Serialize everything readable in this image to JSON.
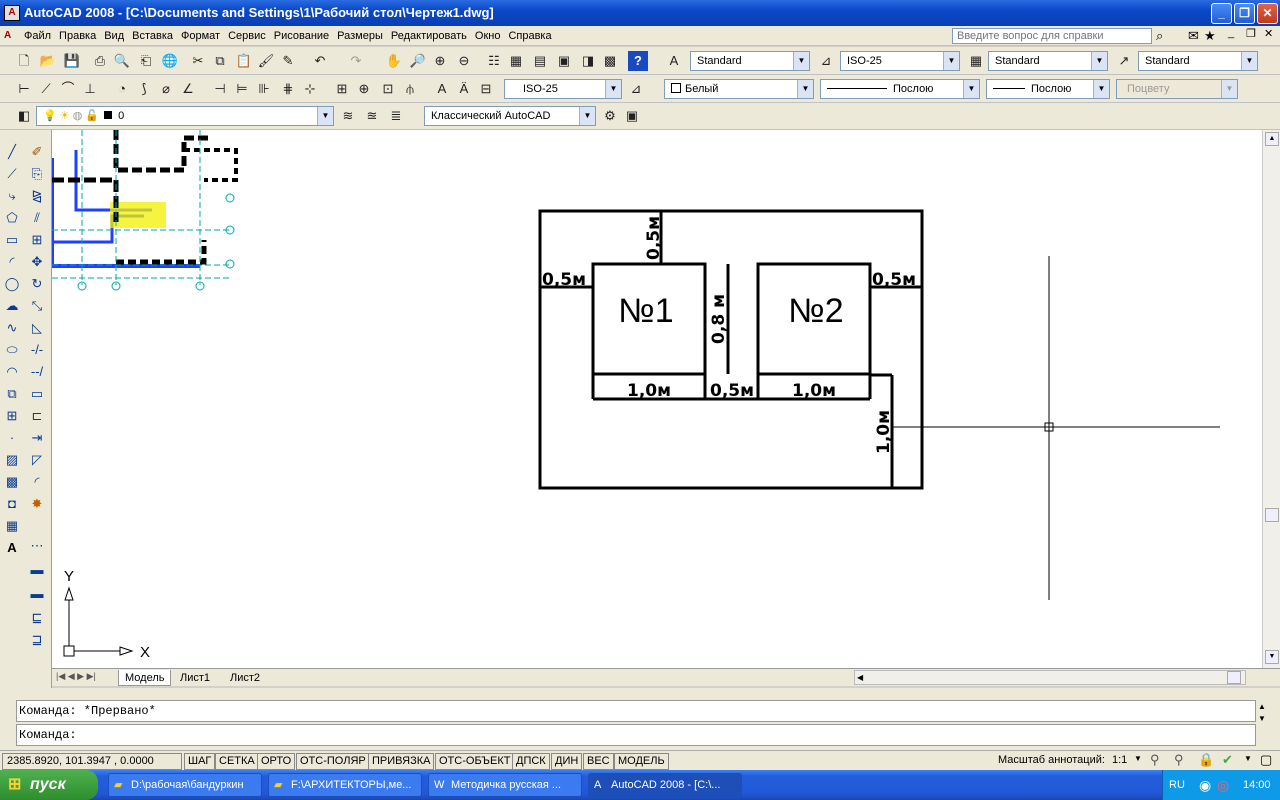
{
  "window": {
    "title": "AutoCAD 2008 - [C:\\Documents and Settings\\1\\Рабочий стол\\Чертеж1.dwg]"
  },
  "menu": [
    "Файл",
    "Правка",
    "Вид",
    "Вставка",
    "Формат",
    "Сервис",
    "Рисование",
    "Размеры",
    "Редактировать",
    "Окно",
    "Справка"
  ],
  "help_search": {
    "placeholder": "Введите вопрос для справки"
  },
  "toolbar_styles": {
    "text_style": "Standard",
    "dim_style": "ISO-25",
    "table_style": "Standard",
    "mleader_style": "Standard"
  },
  "toolbar_dims": {
    "dim_style": "ISO-25"
  },
  "toolbar_props": {
    "color": "Белый",
    "linetype": "Послою",
    "lineweight": "Послою",
    "plotstyle": "Поцвету"
  },
  "toolbar_layers": {
    "layer": "0",
    "workspace": "Классический AutoCAD"
  },
  "drawing": {
    "room1": "№1",
    "room2": "№2",
    "dims": {
      "top": "0,5м",
      "left": "0,5м",
      "right": "0,5м",
      "between": "0,8 м",
      "bottom1": "1,0м",
      "bottom_mid": "0,5м",
      "bottom2": "1,0м",
      "side": "1,0м"
    },
    "ucs": {
      "x": "X",
      "y": "Y"
    }
  },
  "tabs": [
    "Модель",
    "Лист1",
    "Лист2"
  ],
  "command": {
    "history": "Команда: *Прервано*",
    "prompt": "Команда:"
  },
  "status": {
    "coords": "2385.8920, 101.3947 , 0.0000",
    "buttons": [
      "ШАГ",
      "СЕТКА",
      "ОРТО",
      "ОТС-ПОЛЯР",
      "ПРИВЯЗКА",
      "ОТС-ОБЪЕКТ",
      "ДПСК",
      "ДИН",
      "ВЕС",
      "МОДЕЛЬ"
    ],
    "annot_label": "Масштаб аннотаций:",
    "annot_value": "1:1"
  },
  "taskbar": {
    "start": "пуск",
    "tasks": [
      "D:\\рабочая\\бандуркин",
      "F:\\АРХИТЕКТОРЫ,ме...",
      "Методичка русская ...",
      "AutoCAD 2008 - [C:\\..."
    ],
    "lang": "RU",
    "clock": "14:00"
  }
}
